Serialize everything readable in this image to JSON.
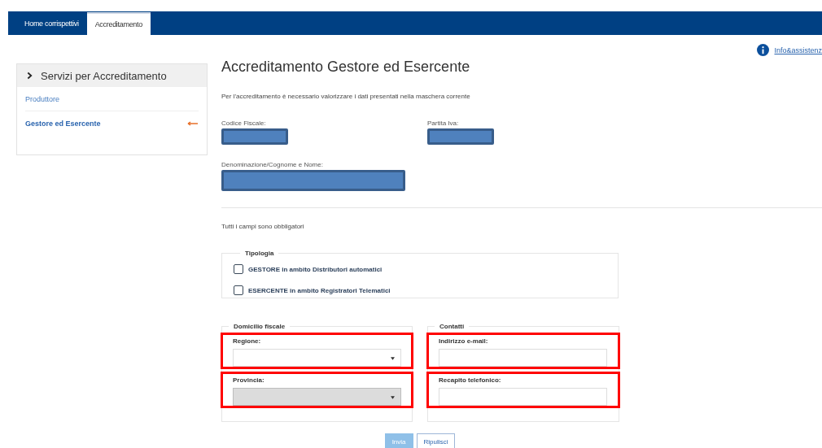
{
  "tabs": [
    {
      "label": "Home corrispettivi",
      "selected": false
    },
    {
      "label": "Accreditamento",
      "selected": true
    }
  ],
  "sidebar": {
    "title": "Servizi per Accreditamento",
    "items": [
      {
        "label": "Produttore",
        "selected": false
      },
      {
        "label": "Gestore ed Esercente",
        "selected": true
      }
    ]
  },
  "help_link": "Info&assistenz",
  "page_title": "Accreditamento Gestore ed Esercente",
  "intro": "Per l'accreditamento è necessario valorizzare i dati presentati nella maschera corrente",
  "identity": [
    {
      "label": "Codice Fiscale:"
    },
    {
      "label": "Partita Iva:"
    },
    {
      "label": "Denominazione/Cognome e Nome:"
    }
  ],
  "required_note": "Tutti i campi sono obbligatori",
  "tipologia": {
    "legend": "Tipologia",
    "options": [
      {
        "label": "GESTORE in ambito Distributori automatici",
        "checked": false
      },
      {
        "label": "ESERCENTE in ambito Registratori Telematici",
        "checked": false
      }
    ]
  },
  "groups": [
    {
      "legend": "Domicilio fiscale",
      "fields": [
        {
          "kind": "select",
          "label": "Regione:",
          "disabled": false,
          "highlighted": true
        },
        {
          "kind": "select",
          "label": "Provincia:",
          "disabled": true,
          "highlighted": true
        }
      ]
    },
    {
      "legend": "Contatti",
      "fields": [
        {
          "kind": "text",
          "label": "Indirizzo e-mail:",
          "disabled": false,
          "highlighted": true
        },
        {
          "kind": "text",
          "label": "Recapito telefonico:",
          "disabled": false,
          "highlighted": true
        }
      ]
    }
  ],
  "buttons": [
    {
      "label": "Invia",
      "kind": "primary",
      "disabled": true
    },
    {
      "label": "Ripulisci",
      "kind": "secondary",
      "disabled": false
    }
  ]
}
